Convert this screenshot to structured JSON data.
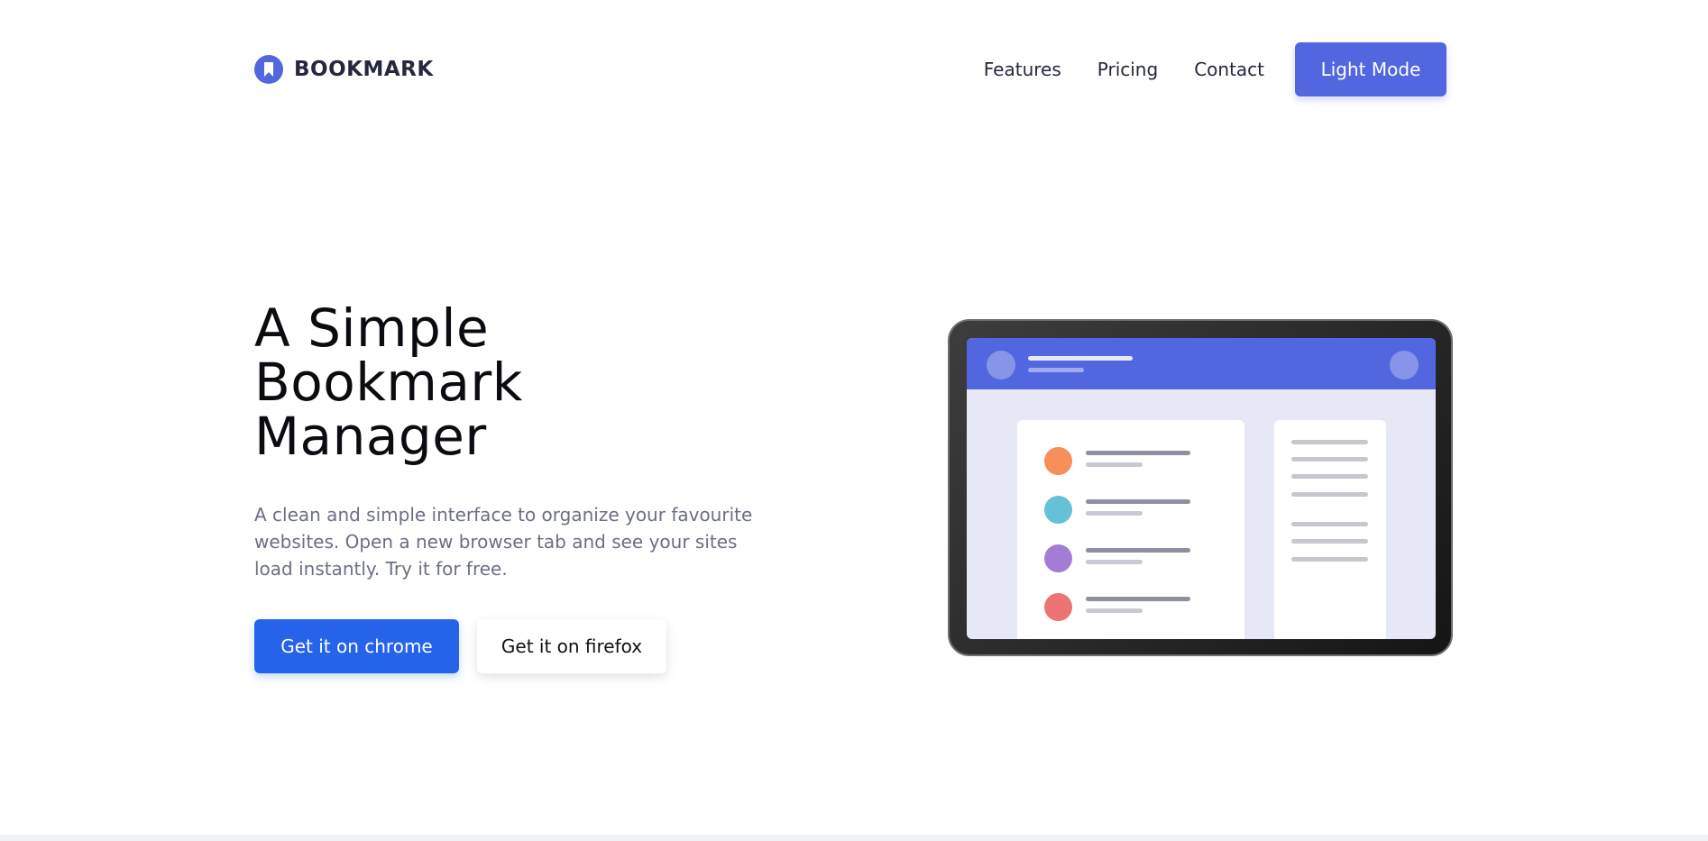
{
  "colors": {
    "accent": "#5267DF",
    "chrome_button": "#2563EB",
    "bookmark_dots": [
      "#F68F5A",
      "#66C1D7",
      "#A27CD5",
      "#EE7374"
    ]
  },
  "nav": {
    "brand": "BOOKMARK",
    "brand_icon": "bookmark-icon",
    "links": [
      "Features",
      "Pricing",
      "Contact"
    ],
    "mode_button": "Light Mode"
  },
  "hero": {
    "title_lines": [
      "A Simple",
      "Bookmark",
      "Manager"
    ],
    "description": "A clean and simple interface to organize your favourite websites. Open a new browser tab and see your sites load instantly. Try it for free.",
    "chrome_button": "Get it on chrome",
    "firefox_button": "Get it on firefox"
  },
  "illustration": {
    "name": "tablet-illustration"
  }
}
